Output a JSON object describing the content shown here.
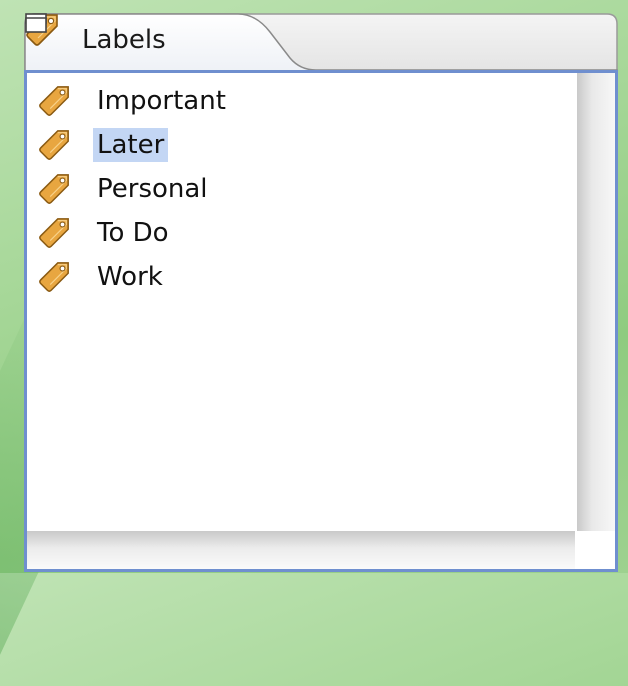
{
  "view": {
    "title": "Labels",
    "icon": "tag-icon",
    "close_icon": "close-icon",
    "minimize_icon": "minimize-icon",
    "maximize_icon": "maximize-icon"
  },
  "labels": {
    "items": [
      {
        "label": "Important",
        "icon": "tag-icon",
        "selected": false
      },
      {
        "label": "Later",
        "icon": "tag-icon",
        "selected": true
      },
      {
        "label": "Personal",
        "icon": "tag-icon",
        "selected": false
      },
      {
        "label": "To Do",
        "icon": "tag-icon",
        "selected": false
      },
      {
        "label": "Work",
        "icon": "tag-icon",
        "selected": false
      }
    ]
  },
  "colors": {
    "tag_fill": "#e8a640",
    "tag_stroke": "#8a5a12",
    "selection": "#c3d6f4",
    "border": "#6f8fcf"
  }
}
